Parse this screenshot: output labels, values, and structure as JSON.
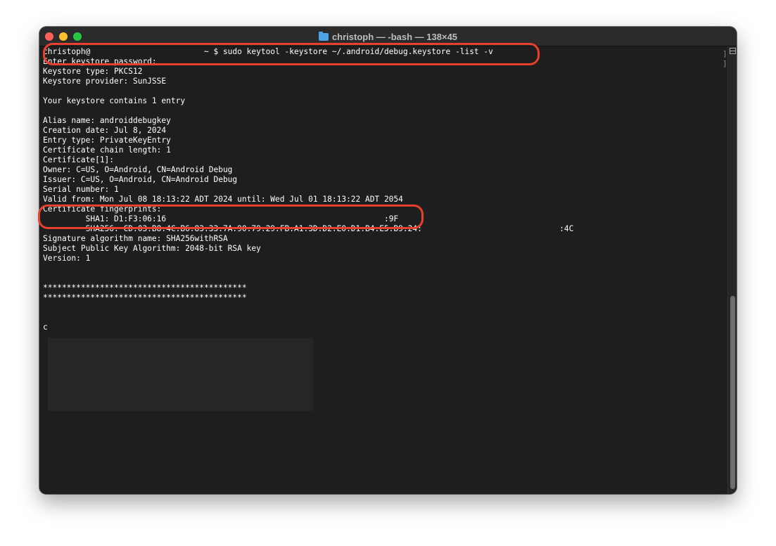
{
  "window": {
    "title": "christoph — -bash — 138×45"
  },
  "terminal": {
    "lines": [
      "christoph@                        ~ $ sudo keytool -keystore ~/.android/debug.keystore -list -v",
      "Enter keystore password:",
      "Keystore type: PKCS12",
      "Keystore provider: SunJSSE",
      "",
      "Your keystore contains 1 entry",
      "",
      "Alias name: androiddebugkey",
      "Creation date: Jul 8, 2024",
      "Entry type: PrivateKeyEntry",
      "Certificate chain length: 1",
      "Certificate[1]:",
      "Owner: C=US, O=Android, CN=Android Debug",
      "Issuer: C=US, O=Android, CN=Android Debug",
      "Serial number: 1",
      "Valid from: Mon Jul 08 18:13:22 ADT 2024 until: Wed Jul 01 18:13:22 ADT 2054",
      "Certificate fingerprints:",
      "\t SHA1: D1:F3:06:16                                              :9F",
      "\t SHA256: CD:03:B8:4C:B6:83:33:7A:90:79:29:FB:A1:3D:D2:E0:D1:B4:E5:B9:24:                             :4C",
      "Signature algorithm name: SHA256withRSA",
      "Subject Public Key Algorithm: 2048-bit RSA key",
      "Version: 1",
      "",
      "",
      "*******************************************",
      "*******************************************",
      "",
      "",
      "c"
    ]
  },
  "colors": {
    "background": "#1e1e1e",
    "text": "#ffffff",
    "annotation": "#e8402d",
    "close": "#ff5f57",
    "minimize": "#febc2e",
    "zoom": "#28c840"
  },
  "icons": {
    "title_icon": "folder-icon",
    "scroll_split": "split-view-icon"
  }
}
